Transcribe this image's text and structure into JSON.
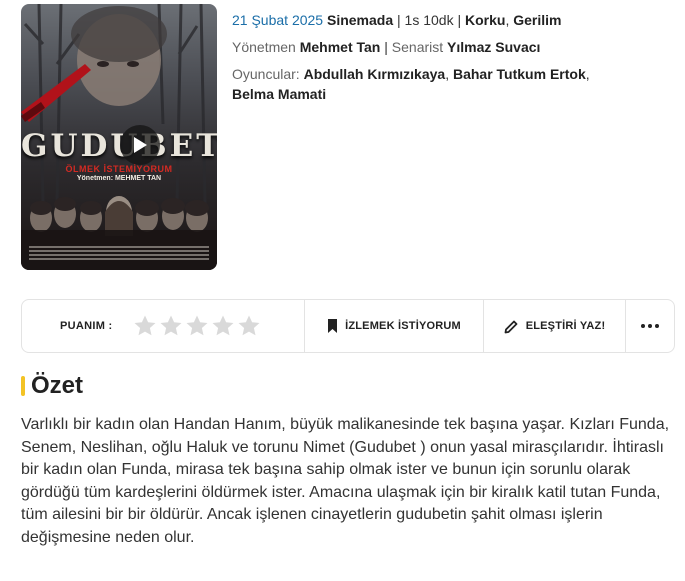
{
  "poster": {
    "title": "GUDUBET",
    "tagline": "ÖLMEK İSTEMİYORUM",
    "director_line": "Yönetmen: MEHMET TAN"
  },
  "movie": {
    "release_date": "21 Şubat 2025",
    "release_place": "Sinemada",
    "separator1": " | ",
    "duration": "1s 10dk",
    "separator2": " | ",
    "genre1": "Korku",
    "genre_sep": ", ",
    "genre2": "Gerilim",
    "director_label": "Yönetmen ",
    "director": "Mehmet Tan",
    "screenwriter_sep": " | ",
    "screenwriter_label": "Senarist ",
    "screenwriter": "Yılmaz Suvacı",
    "cast_label": "Oyuncular: ",
    "cast1": "Abdullah Kırmızıkaya",
    "cast_sep1": ", ",
    "cast2": "Bahar Tutkum Ertok",
    "cast_sep2": ", ",
    "cast3": "Belma Mamati"
  },
  "actions": {
    "rating_label": "PUANIM :",
    "rating_value": 0,
    "rating_max": 5,
    "watchlist_label": "İZLEMEK İSTİYORUM",
    "review_label": "ELEŞTİRİ YAZ!",
    "more_label": "•••"
  },
  "summary": {
    "title": "Özet",
    "text": "Varlıklı bir kadın olan Handan Hanım, büyük malikanesinde tek başına yaşar. Kızları Funda, Senem, Neslihan, oğlu Haluk ve torunu Nimet (Gudubet ) onun yasal mirasçılarıdır. İhtiraslı bir kadın olan Funda, mirasa tek başına sahip olmak ister ve bunun için sorunlu olarak gördüğü tüm kardeşlerini öldürmek ister. Amacına ulaşmak için bir kiralık katil tutan Funda, tüm ailesini bir bir öldürür. Ancak işlenen cinayetlerin gudubetin şahit olması işlerin değişmesine neden olur."
  },
  "colors": {
    "date": "#1b6ea8",
    "accent": "#f3c325",
    "star_empty": "#d9d9d9",
    "poster_title": "#e9e5dc",
    "poster_tagline": "#d32a23"
  },
  "icons": {
    "play": "play-icon",
    "bookmark": "bookmark-icon",
    "pencil": "pencil-icon",
    "star": "star-icon"
  }
}
